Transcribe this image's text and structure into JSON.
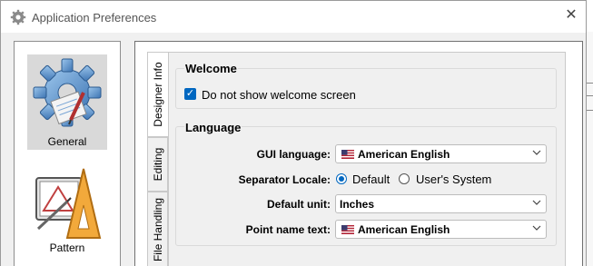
{
  "window": {
    "title": "Application Preferences",
    "close_glyph": "✕"
  },
  "categories": [
    {
      "label": "General",
      "icon": "gear-icon",
      "selected": true
    },
    {
      "label": "Pattern",
      "icon": "drafting-tools-icon",
      "selected": false
    }
  ],
  "tabs": [
    {
      "label": "Designer Info",
      "active": true
    },
    {
      "label": "Editing",
      "active": false
    },
    {
      "label": "File Handling",
      "active": false
    }
  ],
  "welcome": {
    "title": "Welcome",
    "checkbox_label": "Do not show welcome screen",
    "checked": true
  },
  "language": {
    "title": "Language",
    "gui_label": "GUI language:",
    "gui_value": "American English",
    "gui_flag": "us-flag-icon",
    "separator_label": "Separator Locale:",
    "separator_options": [
      "Default",
      "User's System"
    ],
    "separator_selected": "Default",
    "unit_label": "Default unit:",
    "unit_value": "Inches",
    "pointname_label": "Point name text:",
    "pointname_value": "American English",
    "pointname_flag": "us-flag-icon"
  },
  "colors": {
    "accent": "#0067c0",
    "selected_category_bg": "#d9d9d9",
    "dialog_bg": "#f0f0f0"
  }
}
